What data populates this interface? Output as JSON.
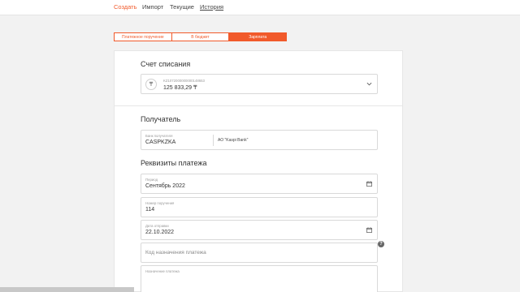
{
  "nav": {
    "items": [
      {
        "label": "Создать"
      },
      {
        "label": "Импорт"
      },
      {
        "label": "Текущие"
      },
      {
        "label": "История"
      }
    ]
  },
  "tabs": [
    {
      "label": "Платежное поручение"
    },
    {
      "label": "В бюджет"
    },
    {
      "label": "Зарплата"
    }
  ],
  "colors": {
    "accent": "#f15a2b"
  },
  "account": {
    "title": "Счет списания",
    "currency_icon": "₸",
    "number": "KZ1072000000000148653",
    "balance": "125 833,29 ₸"
  },
  "recipient": {
    "title": "Получатель",
    "bic_label": "Банк получателя",
    "bic_value": "CASPKZKA",
    "bank_name": "АО \"Kaspi Bank\""
  },
  "details": {
    "title": "Реквизиты платежа",
    "period_label": "Период",
    "period_value": "Сентябрь 2022",
    "number_label": "Номер поручения",
    "number_value": "114",
    "date_label": "Дата отправки",
    "date_value": "22.10.2022",
    "code_placeholder": "Код назначения платежа",
    "purpose_label": "Назначение платежа"
  },
  "help_symbol": "?"
}
